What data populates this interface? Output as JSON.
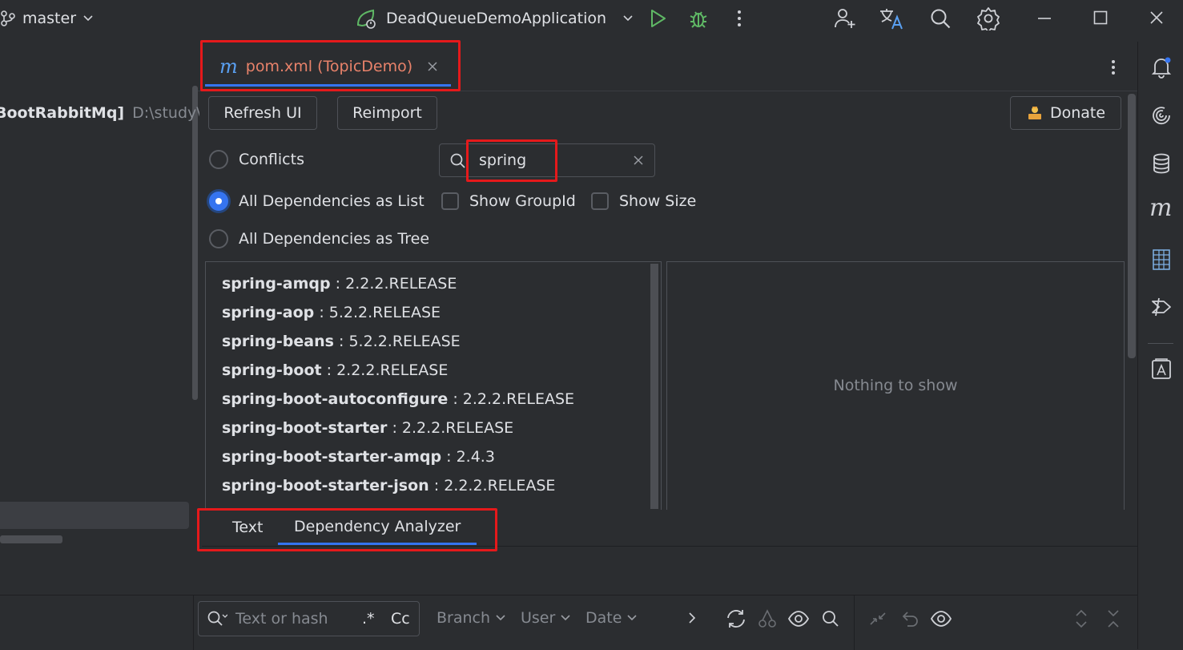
{
  "titlebar": {
    "branch": "master",
    "run_config": "DeadQueueDemoApplication"
  },
  "project": {
    "root_name": "BootRabbitMq]",
    "root_path": "D:\\study\\jav"
  },
  "editor": {
    "tab_label": "pom.xml (TopicDemo)",
    "tab_icon": "m",
    "refresh_label": "Refresh UI",
    "reimport_label": "Reimport",
    "donate_label": "Donate",
    "search_value": "spring",
    "options": {
      "conflicts": "Conflicts",
      "all_list": "All Dependencies as List",
      "all_tree": "All Dependencies as Tree",
      "selected": "all_list",
      "show_groupid": "Show GroupId",
      "show_size": "Show Size"
    },
    "dependencies": [
      {
        "name": "spring-amqp",
        "version": "2.2.2.RELEASE"
      },
      {
        "name": "spring-aop",
        "version": "5.2.2.RELEASE"
      },
      {
        "name": "spring-beans",
        "version": "5.2.2.RELEASE"
      },
      {
        "name": "spring-boot",
        "version": "2.2.2.RELEASE"
      },
      {
        "name": "spring-boot-autoconfigure",
        "version": "2.2.2.RELEASE"
      },
      {
        "name": "spring-boot-starter",
        "version": "2.2.2.RELEASE"
      },
      {
        "name": "spring-boot-starter-amqp",
        "version": "2.4.3"
      },
      {
        "name": "spring-boot-starter-json",
        "version": "2.2.2.RELEASE"
      }
    ],
    "detail_empty": "Nothing to show",
    "bottom_tabs": [
      "Text",
      "Dependency Analyzer"
    ],
    "active_bottom_tab": "Dependency Analyzer"
  },
  "vcs": {
    "search_placeholder": "Text or hash",
    "regex_label": ".*",
    "case_label": "Cc",
    "filters": [
      "Branch",
      "User",
      "Date"
    ]
  },
  "colors": {
    "accent": "#3574f0",
    "run_green": "#5fb865",
    "highlight_red": "#e5191b"
  }
}
